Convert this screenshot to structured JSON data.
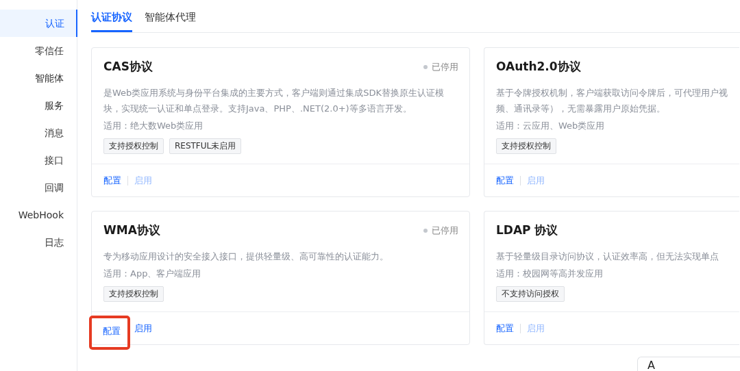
{
  "sidebar": {
    "items": [
      {
        "label": "认证",
        "selected": true
      },
      {
        "label": "零信任",
        "selected": false
      },
      {
        "label": "智能体",
        "selected": false
      },
      {
        "label": "服务",
        "selected": false
      },
      {
        "label": "消息",
        "selected": false
      },
      {
        "label": "接口",
        "selected": false
      },
      {
        "label": "回调",
        "selected": false
      },
      {
        "label": "WebHook",
        "selected": false
      },
      {
        "label": "日志",
        "selected": false
      }
    ]
  },
  "tabs": [
    {
      "label": "认证协议",
      "selected": true
    },
    {
      "label": "智能体代理",
      "selected": false
    }
  ],
  "cards": [
    {
      "title": "CAS协议",
      "status": "已停用",
      "description": "是Web类应用系统与身份平台集成的主要方式，客户端则通过集成SDK替换原生认证模块，实现统一认证和单点登录。支持Java、PHP、.NET(2.0+)等多语言开发。",
      "scope": "适用：绝大数Web类应用",
      "tags": [
        "支持授权控制",
        "RESTFUL未启用"
      ],
      "actions": [
        {
          "label": "配置",
          "disabled": false,
          "highlighted": false
        },
        {
          "label": "启用",
          "disabled": true,
          "highlighted": false
        }
      ]
    },
    {
      "title": "OAuth2.0协议",
      "description": "基于令牌授权机制，客户端获取访问令牌后，可代理用户视频、通讯录等），无需暴露用户原始凭据。",
      "scope": "适用：云应用、Web类应用",
      "tags": [
        "支持授权控制"
      ],
      "actions": [
        {
          "label": "配置",
          "disabled": false,
          "highlighted": false
        },
        {
          "label": "启用",
          "disabled": true,
          "highlighted": false
        }
      ]
    },
    {
      "title": "WMA协议",
      "status": "已停用",
      "description": "专为移动应用设计的安全接入接口，提供轻量级、高可靠性的认证能力。",
      "scope": "适用：App、客户端应用",
      "tags": [
        "支持授权控制"
      ],
      "actions": [
        {
          "label": "配置",
          "disabled": false,
          "highlighted": true
        },
        {
          "label": "启用",
          "disabled": false,
          "highlighted": false
        }
      ]
    },
    {
      "title": "LDAP 协议",
      "description": "基于轻量级目录访问协议，认证效率高，但无法实现单点",
      "scope": "适用：校园网等高并发应用",
      "tags": [
        "不支持访问授权"
      ],
      "actions": [
        {
          "label": "配置",
          "disabled": false,
          "highlighted": false
        },
        {
          "label": "启用",
          "disabled": true,
          "highlighted": false
        }
      ]
    }
  ],
  "floating_input": {
    "value": "A"
  }
}
